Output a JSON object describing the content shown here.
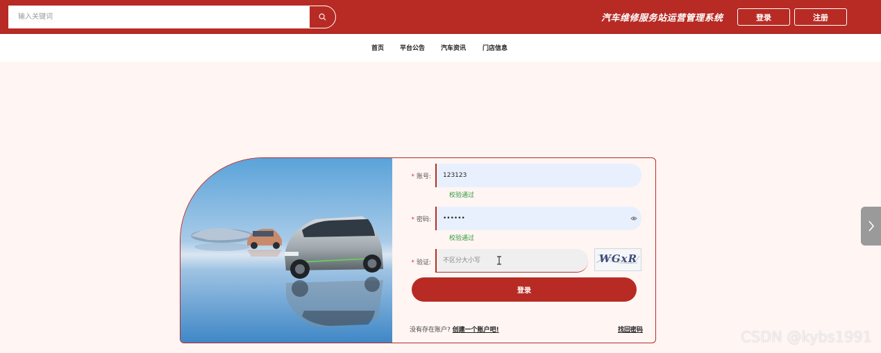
{
  "header": {
    "search_placeholder": "输入关键词",
    "system_title": "汽车维修服务站运营管理系统",
    "login_label": "登录",
    "register_label": "注册"
  },
  "nav": {
    "items": [
      {
        "label": "首页"
      },
      {
        "label": "平台公告"
      },
      {
        "label": "汽车资讯"
      },
      {
        "label": "门店信息"
      }
    ]
  },
  "login_form": {
    "account": {
      "label": "账号:",
      "value": "123123",
      "status": "校验通过"
    },
    "password": {
      "label": "密码:",
      "value": "••••••",
      "status": "校验通过"
    },
    "captcha": {
      "label": "验证:",
      "placeholder": "不区分大小写",
      "code": "WGxR"
    },
    "submit_label": "登录",
    "no_account_text": "没有存在账户?",
    "create_account_link": "创建一个账户吧!",
    "forgot_link": "找回密码"
  },
  "watermark": "CSDN @kybs1991",
  "colors": {
    "brand_red": "#b72b24",
    "page_bg": "#fff5f3",
    "input_bg": "#e8f0fe",
    "success_green": "#2e9a3b"
  },
  "icons": {
    "search": "search-icon",
    "eye": "eye-icon",
    "arrow": "chevron-right-icon"
  }
}
